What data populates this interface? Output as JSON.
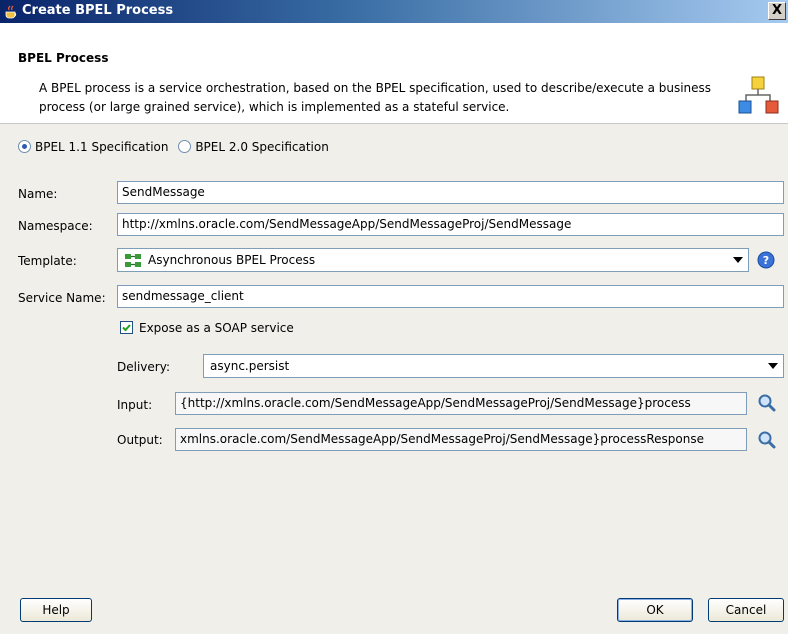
{
  "window": {
    "title": "Create BPEL Process",
    "close_label": "X"
  },
  "header": {
    "title": "BPEL Process",
    "description": "A BPEL process is a service orchestration, based on the BPEL specification, used to describe/execute a business process (or large grained service), which is implemented as a stateful service."
  },
  "spec": {
    "options": [
      "BPEL 1.1 Specification",
      "BPEL 2.0 Specification"
    ],
    "selected": "BPEL 1.1 Specification"
  },
  "form": {
    "name": {
      "label": "Name:",
      "value": "SendMessage"
    },
    "namespace": {
      "label": "Namespace:",
      "value": "http://xmlns.oracle.com/SendMessageApp/SendMessageProj/SendMessage"
    },
    "template": {
      "label": "Template:",
      "value": "Asynchronous BPEL Process"
    },
    "service_name": {
      "label": "Service Name:",
      "value": "sendmessage_client"
    },
    "expose": {
      "label": "Expose as a SOAP service",
      "checked": true
    },
    "delivery": {
      "label": "Delivery:",
      "value": "async.persist"
    },
    "input": {
      "label": "Input:",
      "value": "{http://xmlns.oracle.com/SendMessageApp/SendMessageProj/SendMessage}process"
    },
    "output": {
      "label": "Output:",
      "value": "xmlns.oracle.com/SendMessageApp/SendMessageProj/SendMessage}processResponse"
    }
  },
  "buttons": {
    "help": "Help",
    "ok": "OK",
    "cancel": "Cancel"
  },
  "icons": {
    "titlebar": "java-cup-icon",
    "header": "bpel-process-icon",
    "template": "process-template-icon",
    "help": "help-icon",
    "browse": "magnifier-icon"
  }
}
